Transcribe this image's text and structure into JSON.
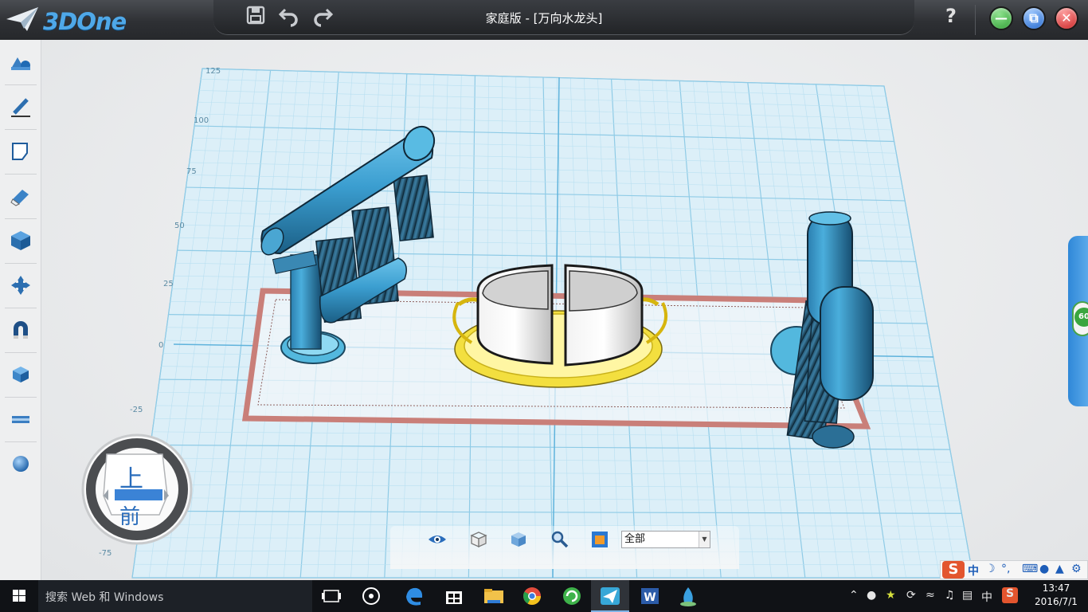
{
  "app": {
    "logo_text": "3DOne",
    "title": "家庭版 - [万向水龙头]",
    "help_label": "?"
  },
  "quick_access": [
    {
      "name": "save",
      "icon": "save-icon"
    },
    {
      "name": "undo",
      "icon": "undo-icon"
    },
    {
      "name": "redo",
      "icon": "redo-icon"
    }
  ],
  "window_controls": {
    "minimize_color": "#3cb043",
    "restore_color": "#2a7de1",
    "close_color": "#e3342f"
  },
  "left_toolbar": [
    {
      "name": "basic-solids",
      "icon": "solids-icon"
    },
    {
      "name": "sketch-draw",
      "icon": "pencil-icon"
    },
    {
      "name": "sketch-edit",
      "icon": "sketch-edit-icon"
    },
    {
      "name": "feature-modeling",
      "icon": "eraser-icon"
    },
    {
      "name": "special-features",
      "icon": "cube-icon"
    },
    {
      "name": "basic-edit",
      "icon": "move-arrows-icon"
    },
    {
      "name": "combine",
      "icon": "magnet-icon"
    },
    {
      "name": "color",
      "icon": "paint-cube-icon"
    },
    {
      "name": "measure",
      "icon": "ruler-icon"
    },
    {
      "name": "material",
      "icon": "sphere-icon"
    }
  ],
  "grid_labels": {
    "y": [
      "125",
      "100",
      "75",
      "50",
      "25",
      "0",
      "-25",
      "-75"
    ]
  },
  "view_cube": {
    "top": "上",
    "front": "前"
  },
  "view_toolbar": {
    "icons": [
      "eye-icon",
      "wireframe-cube-icon",
      "shaded-cube-icon",
      "zoom-icon",
      "render-icon"
    ],
    "filter_value": "全部"
  },
  "side_tab": {
    "badge": "60"
  },
  "ime": {
    "logo": "S",
    "mode": "中",
    "icons": [
      "moon-icon",
      "punctuation-icon",
      "keyboard-icon",
      "user-icon",
      "shirt-icon",
      "wrench-icon"
    ]
  },
  "taskbar": {
    "search_placeholder": "搜索 Web 和 Windows",
    "apps": [
      "task-view-icon",
      "pinwheel-icon",
      "edge-icon",
      "store-icon",
      "explorer-icon",
      "chrome-icon",
      "refresh-app-icon",
      "3done-icon",
      "word-icon",
      "slicer-icon"
    ],
    "tray_lang": "中",
    "time": "13:47",
    "date": "2016/7/1"
  }
}
